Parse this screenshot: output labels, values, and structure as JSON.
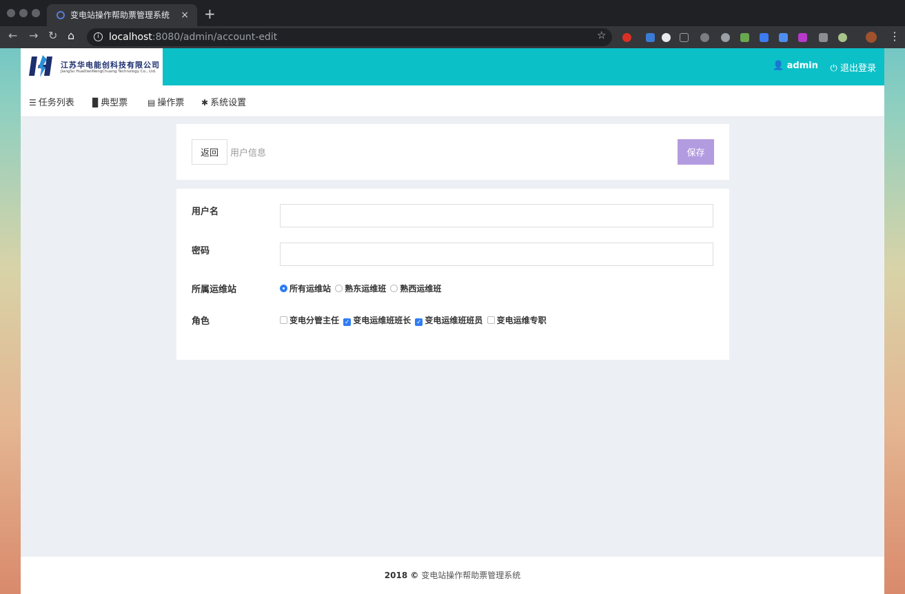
{
  "browser": {
    "tab_title": "变电站操作帮助票管理系统",
    "tab_close": "×",
    "new_tab": "+",
    "url_host": "localhost",
    "url_path": ":8080/admin/account-edit"
  },
  "header": {
    "company_cn": "江苏华电能创科技有限公司",
    "company_en": "JiangSu HuaDianNengChuang Technology Co., Ltd.",
    "user": "admin",
    "logout": "退出登录"
  },
  "nav": {
    "items": [
      {
        "label": "任务列表",
        "icon": "list-icon"
      },
      {
        "label": "典型票",
        "icon": "file-icon"
      },
      {
        "label": "操作票",
        "icon": "file-text-icon"
      },
      {
        "label": "系统设置",
        "icon": "gear-icon"
      }
    ]
  },
  "toolbar": {
    "back_label": "返回",
    "title": "用户信息",
    "save_label": "保存",
    "save_color": "#b39be0"
  },
  "form": {
    "username_label": "用户名",
    "username_value": "",
    "password_label": "密码",
    "password_value": "",
    "station_label": "所属运维站",
    "stations": [
      {
        "label": "所有运维站",
        "selected": true
      },
      {
        "label": "熟东运维班",
        "selected": false
      },
      {
        "label": "熟西运维班",
        "selected": false
      }
    ],
    "role_label": "角色",
    "roles": [
      {
        "label": "变电分管主任",
        "checked": false
      },
      {
        "label": "变电运维班班长",
        "checked": true
      },
      {
        "label": "变电运维班班员",
        "checked": true
      },
      {
        "label": "变电运维专职",
        "checked": false
      }
    ]
  },
  "footer": {
    "year": "2018 ©",
    "text": "变电站操作帮助票管理系统"
  },
  "colors": {
    "header_bg": "#0cc0c8",
    "accent_blue": "#2e7cf6"
  }
}
